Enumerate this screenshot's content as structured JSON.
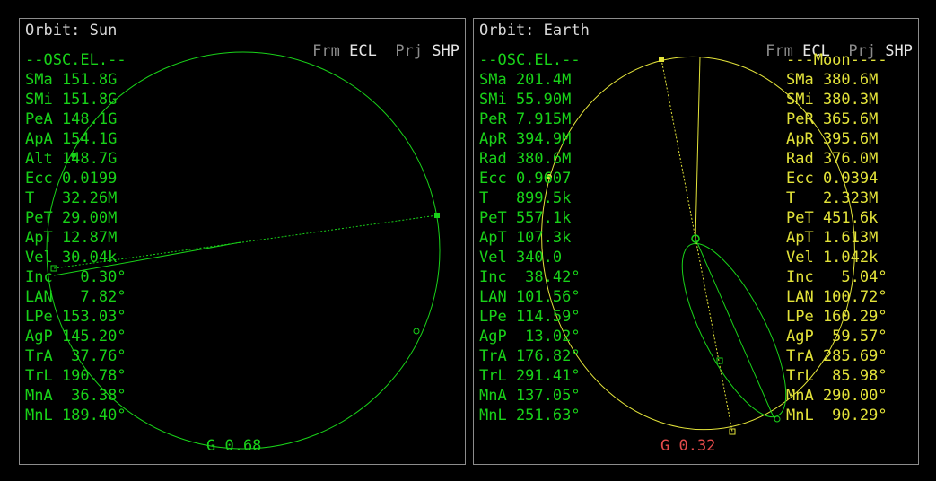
{
  "left": {
    "title": "Orbit: Sun",
    "frm_label": "Frm",
    "frm_value": "ECL",
    "prj_label": "Prj",
    "prj_value": "SHP",
    "section": "--OSC.EL.--",
    "elements": [
      "SMa 151.8G",
      "SMi 151.8G",
      "PeA 148.1G",
      "ApA 154.1G",
      "Alt 148.7G",
      "Ecc 0.0199",
      "T   32.26M",
      "PeT 29.00M",
      "ApT 12.87M",
      "Vel 30.04k",
      "Inc   0.30°",
      "LAN   7.82°",
      "LPe 153.03°",
      "AgP 145.20°",
      "TrA  37.76°",
      "TrL 190.78°",
      "MnA  36.38°",
      "MnL 189.40°"
    ],
    "g": "G 0.68",
    "colors": {
      "orbit": "#19d219",
      "text": "#19d219"
    }
  },
  "right": {
    "title": "Orbit: Earth",
    "frm_label": "Frm",
    "frm_value": "ECL",
    "prj_label": "Prj",
    "prj_value": "SHP",
    "section": "--OSC.EL.--",
    "elements": [
      "SMa 201.4M",
      "SMi 55.90M",
      "PeR 7.915M",
      "ApR 394.9M",
      "Rad 380.6M",
      "Ecc 0.9607",
      "T   899.5k",
      "PeT 557.1k",
      "ApT 107.3k",
      "Vel 340.0",
      "Inc  38.42°",
      "LAN 101.56°",
      "LPe 114.59°",
      "AgP  13.02°",
      "TrA 176.82°",
      "TrL 291.41°",
      "MnA 137.05°",
      "MnL 251.63°"
    ],
    "target_section": "---Moon----",
    "target_elements": [
      "SMa 380.6M",
      "SMi 380.3M",
      "PeR 365.6M",
      "ApR 395.6M",
      "Rad 376.0M",
      "Ecc 0.0394",
      "T   2.323M",
      "PeT 451.6k",
      "ApT 1.613M",
      "Vel 1.042k",
      "Inc   5.04°",
      "LAN 100.72°",
      "LPe 160.29°",
      "AgP  59.57°",
      "TrA 285.69°",
      "TrL  85.98°",
      "MnA 290.00°",
      "MnL  90.29°"
    ],
    "g": "G 0.32",
    "colors": {
      "orbit": "#19d219",
      "target_orbit": "#e3e33a",
      "g_text": "#e34b4b"
    }
  }
}
